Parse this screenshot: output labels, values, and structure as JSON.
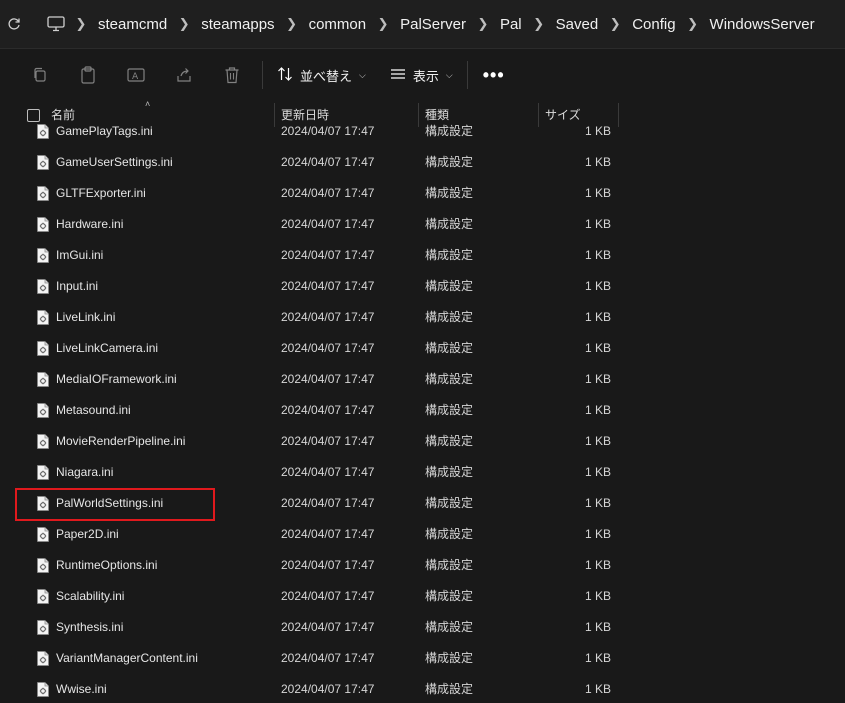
{
  "address": {
    "breadcrumbs": [
      "steamcmd",
      "steamapps",
      "common",
      "PalServer",
      "Pal",
      "Saved",
      "Config",
      "WindowsServer"
    ]
  },
  "toolbar": {
    "sort_label": "並べ替え",
    "view_label": "表示",
    "more_label": "•••"
  },
  "columns": {
    "name": "名前",
    "date": "更新日時",
    "type": "種類",
    "size": "サイズ"
  },
  "files": [
    {
      "name": "GamePlayTags.ini",
      "date": "2024/04/07 17:47",
      "type": "構成設定",
      "size": "1 KB"
    },
    {
      "name": "GameUserSettings.ini",
      "date": "2024/04/07 17:47",
      "type": "構成設定",
      "size": "1 KB"
    },
    {
      "name": "GLTFExporter.ini",
      "date": "2024/04/07 17:47",
      "type": "構成設定",
      "size": "1 KB"
    },
    {
      "name": "Hardware.ini",
      "date": "2024/04/07 17:47",
      "type": "構成設定",
      "size": "1 KB"
    },
    {
      "name": "ImGui.ini",
      "date": "2024/04/07 17:47",
      "type": "構成設定",
      "size": "1 KB"
    },
    {
      "name": "Input.ini",
      "date": "2024/04/07 17:47",
      "type": "構成設定",
      "size": "1 KB"
    },
    {
      "name": "LiveLink.ini",
      "date": "2024/04/07 17:47",
      "type": "構成設定",
      "size": "1 KB"
    },
    {
      "name": "LiveLinkCamera.ini",
      "date": "2024/04/07 17:47",
      "type": "構成設定",
      "size": "1 KB"
    },
    {
      "name": "MediaIOFramework.ini",
      "date": "2024/04/07 17:47",
      "type": "構成設定",
      "size": "1 KB"
    },
    {
      "name": "Metasound.ini",
      "date": "2024/04/07 17:47",
      "type": "構成設定",
      "size": "1 KB"
    },
    {
      "name": "MovieRenderPipeline.ini",
      "date": "2024/04/07 17:47",
      "type": "構成設定",
      "size": "1 KB"
    },
    {
      "name": "Niagara.ini",
      "date": "2024/04/07 17:47",
      "type": "構成設定",
      "size": "1 KB"
    },
    {
      "name": "PalWorldSettings.ini",
      "date": "2024/04/07 17:47",
      "type": "構成設定",
      "size": "1 KB"
    },
    {
      "name": "Paper2D.ini",
      "date": "2024/04/07 17:47",
      "type": "構成設定",
      "size": "1 KB"
    },
    {
      "name": "RuntimeOptions.ini",
      "date": "2024/04/07 17:47",
      "type": "構成設定",
      "size": "1 KB"
    },
    {
      "name": "Scalability.ini",
      "date": "2024/04/07 17:47",
      "type": "構成設定",
      "size": "1 KB"
    },
    {
      "name": "Synthesis.ini",
      "date": "2024/04/07 17:47",
      "type": "構成設定",
      "size": "1 KB"
    },
    {
      "name": "VariantManagerContent.ini",
      "date": "2024/04/07 17:47",
      "type": "構成設定",
      "size": "1 KB"
    },
    {
      "name": "Wwise.ini",
      "date": "2024/04/07 17:47",
      "type": "構成設定",
      "size": "1 KB"
    }
  ],
  "highlight_color": "#e0191d",
  "icons": [
    "refresh-icon",
    "pc-icon",
    "chevron-right-icon",
    "copy-icon",
    "paste-icon",
    "rename-icon",
    "share-icon",
    "delete-icon",
    "sort-icon",
    "view-icon",
    "ini-file-icon"
  ]
}
